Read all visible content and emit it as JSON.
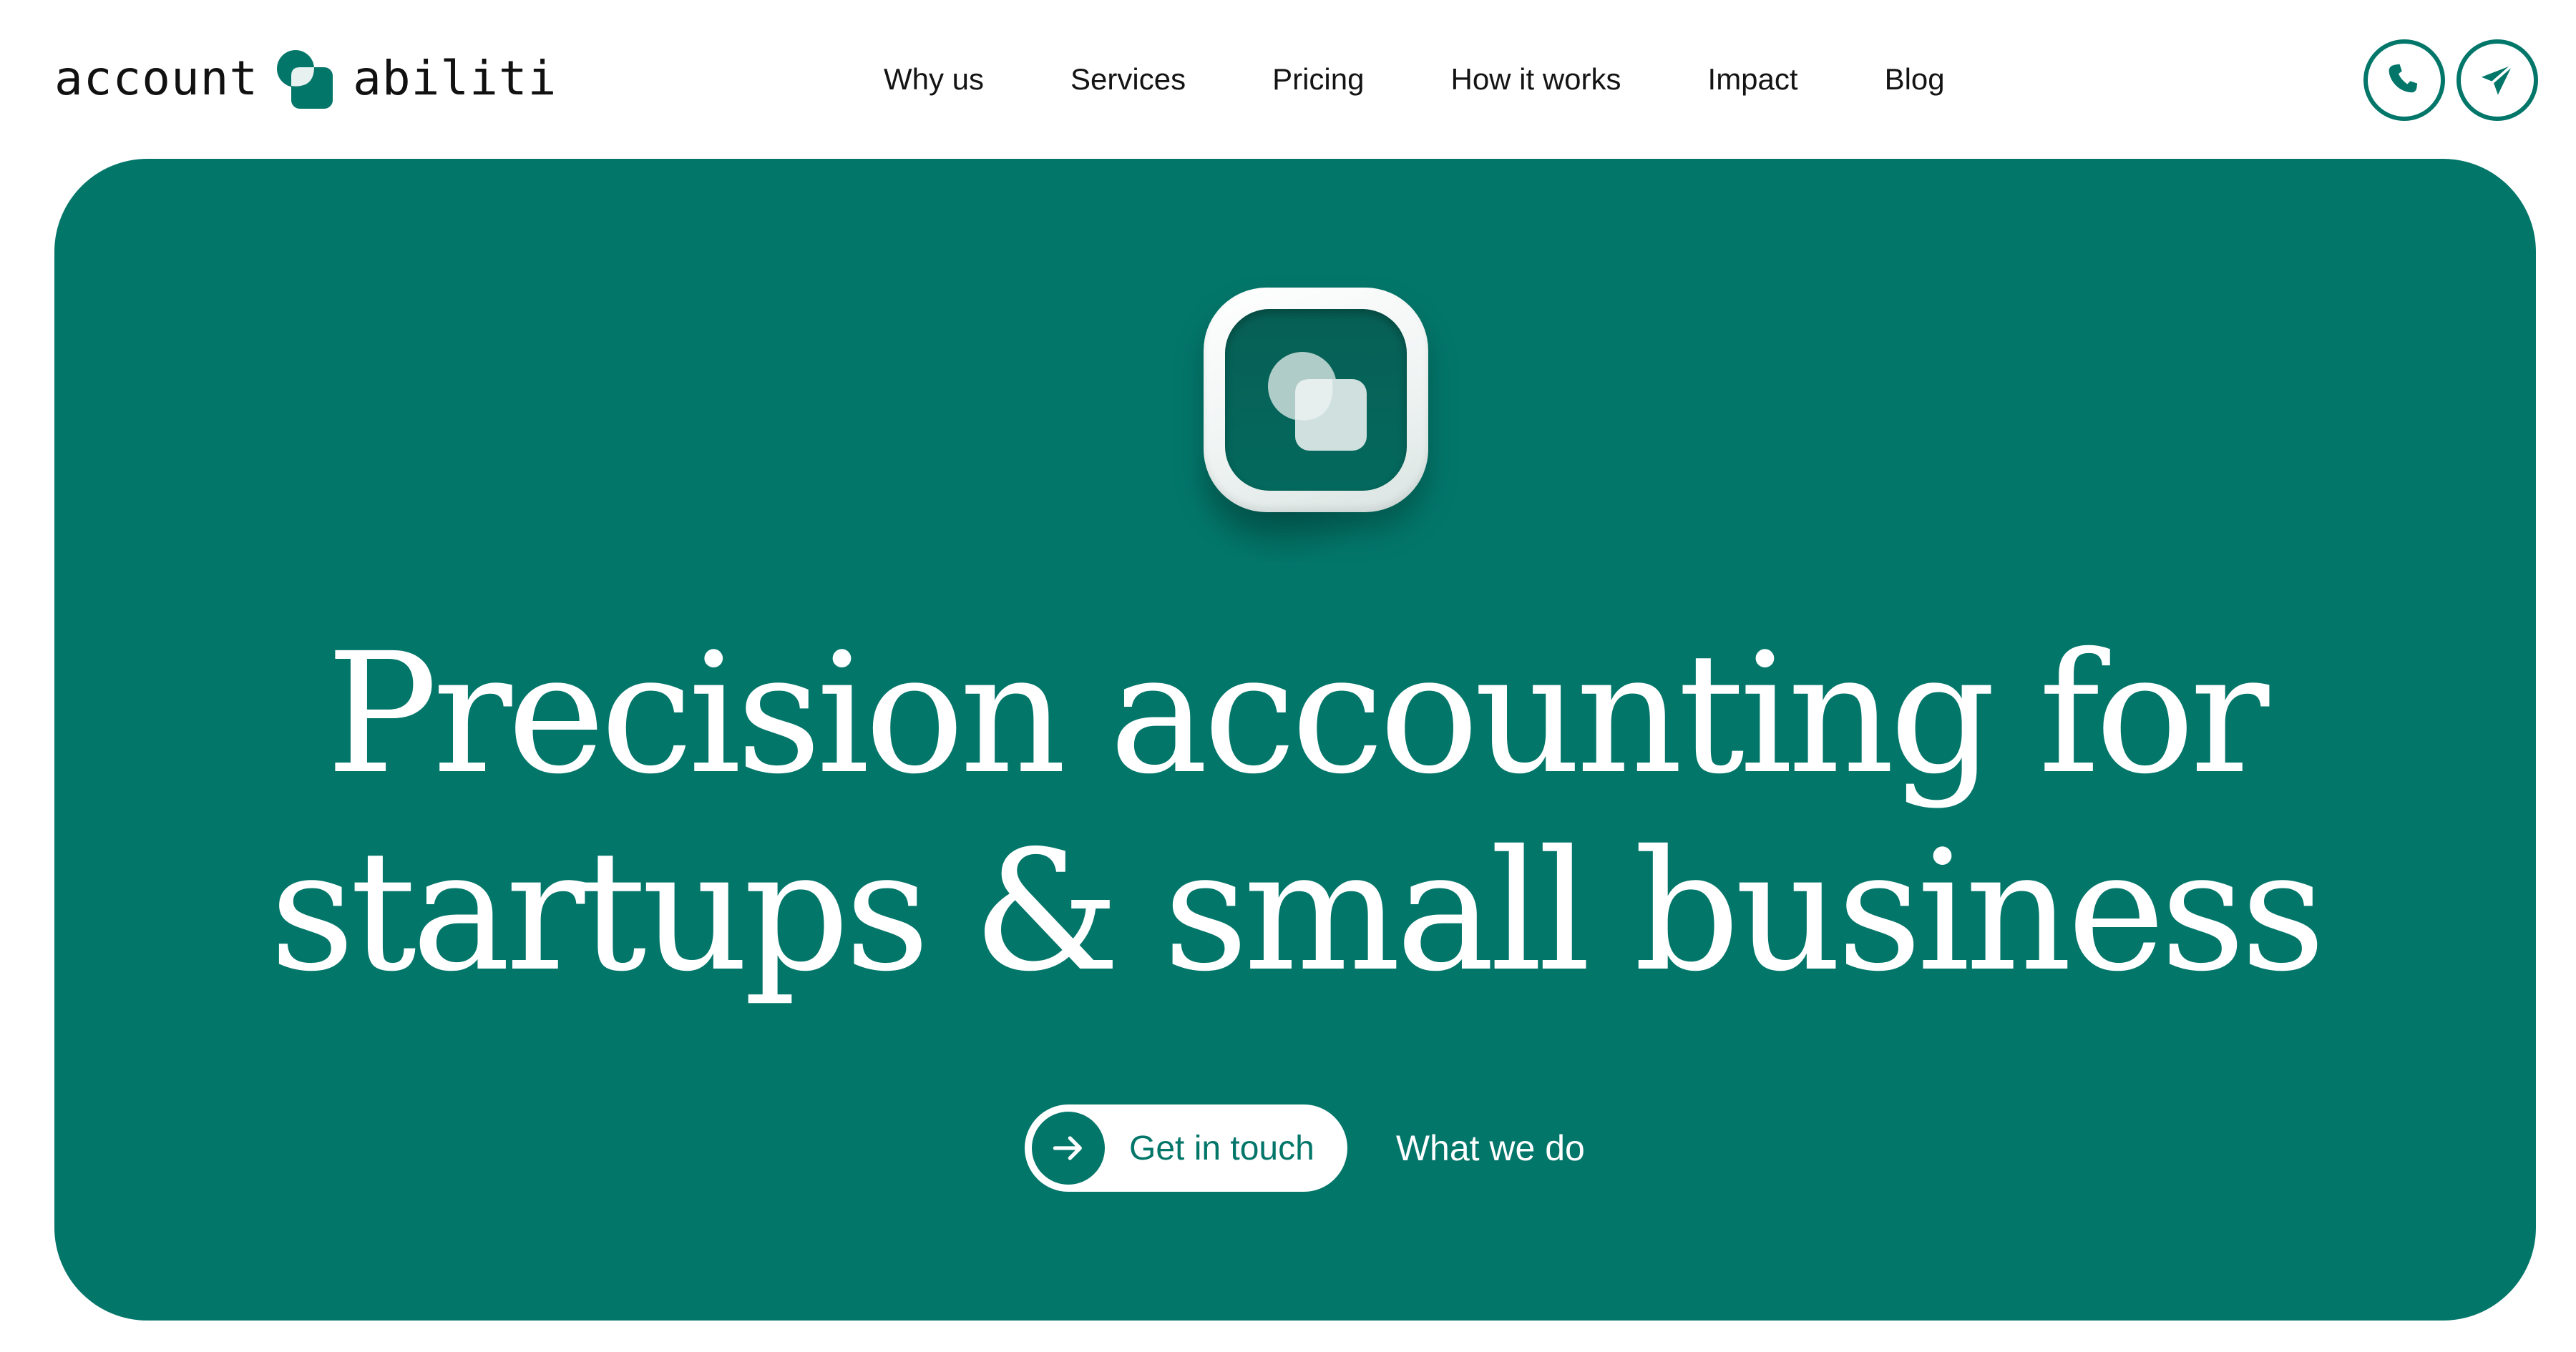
{
  "brand": {
    "word_left": "account",
    "word_right": "abiliti",
    "primary_color": "#03766a",
    "logo_icon": "logo-mark-icon"
  },
  "nav": {
    "items": [
      {
        "label": "Why us"
      },
      {
        "label": "Services"
      },
      {
        "label": "Pricing"
      },
      {
        "label": "How it works"
      },
      {
        "label": "Impact"
      },
      {
        "label": "Blog"
      }
    ]
  },
  "header_actions": {
    "phone_icon": "phone-icon",
    "send_icon": "paper-plane-icon"
  },
  "hero": {
    "background_color": "#03766a",
    "app_icon": "app-logo-icon",
    "headline_line1": "Precision accounting for",
    "headline_line2": "startups & small business",
    "primary_cta": {
      "label": "Get in touch",
      "icon": "arrow-right-icon"
    },
    "secondary_cta": {
      "label": "What we do"
    }
  }
}
